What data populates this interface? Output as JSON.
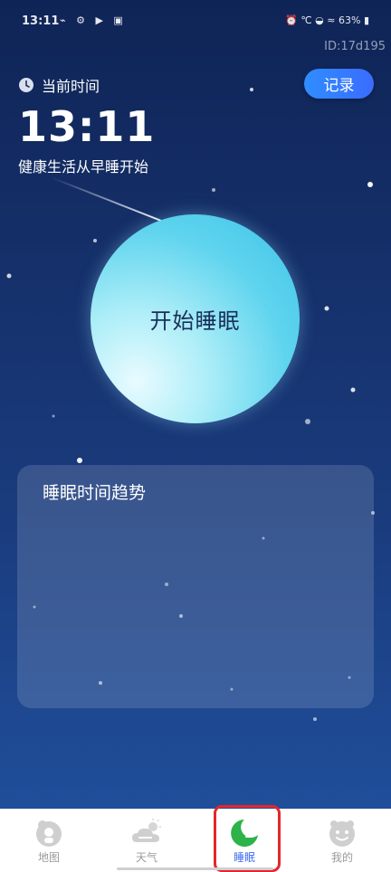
{
  "status_bar": {
    "time": "13:11",
    "left_icons": "⌁ ⚙ ▶ ▣",
    "right_text": "⏰ ℃ ◒ ≈ 63% ▮"
  },
  "user_id": "ID:17d195",
  "header": {
    "current_time_label": "当前时间",
    "record_button": "记录",
    "clock_value": "13:11",
    "slogan": "健康生活从早睡开始"
  },
  "sleep_button": {
    "label": "开始睡眠"
  },
  "trend_card": {
    "title": "睡眠时间趋势"
  },
  "tabs": [
    {
      "label": "地图",
      "icon": "map-face-icon",
      "active": false
    },
    {
      "label": "天气",
      "icon": "weather-cloud-icon",
      "active": false
    },
    {
      "label": "睡眠",
      "icon": "moon-sleep-icon",
      "active": true
    },
    {
      "label": "我的",
      "icon": "profile-face-icon",
      "active": false
    }
  ],
  "colors": {
    "accent": "#3d6cf0",
    "record_button": "#2f8dff",
    "orb": "#3cc3e8",
    "highlight": "#e4262d",
    "sleep_icon": "#2db34a"
  }
}
